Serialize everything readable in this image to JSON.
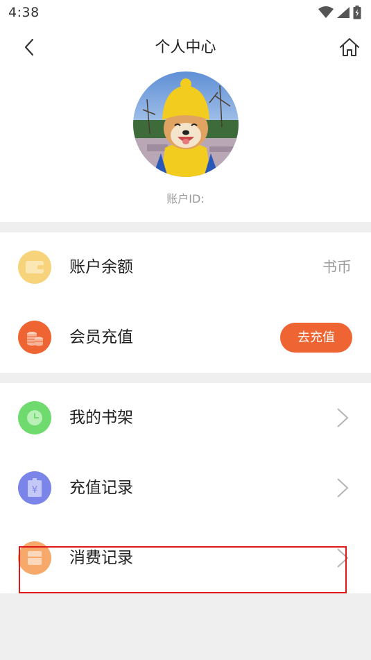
{
  "status_bar": {
    "time": "4:38",
    "icons": [
      "wifi-icon",
      "signal-icon",
      "battery-icon"
    ]
  },
  "header": {
    "title": "个人中心",
    "back_icon": "back-chevron-icon",
    "home_icon": "home-icon",
    "account_id_label": "账户ID:"
  },
  "account_card": {
    "balance": {
      "label": "账户余额",
      "value": "书币",
      "icon": "wallet-icon",
      "icon_color": "#f7d47c"
    },
    "vip": {
      "label": "会员充值",
      "button": "去充值",
      "icon": "coins-icon",
      "icon_color": "#ee6433"
    }
  },
  "menu": [
    {
      "label": "我的书架",
      "icon": "clock-icon",
      "icon_color": "#6fdb6f"
    },
    {
      "label": "充值记录",
      "icon": "yen-receipt-icon",
      "icon_color": "#7b84e8"
    },
    {
      "label": "消费记录",
      "icon": "bag-icon",
      "icon_color": "#f6a96a"
    }
  ],
  "colors": {
    "accent": "#ee6433",
    "background": "#efefef",
    "highlight": "#e01818"
  }
}
